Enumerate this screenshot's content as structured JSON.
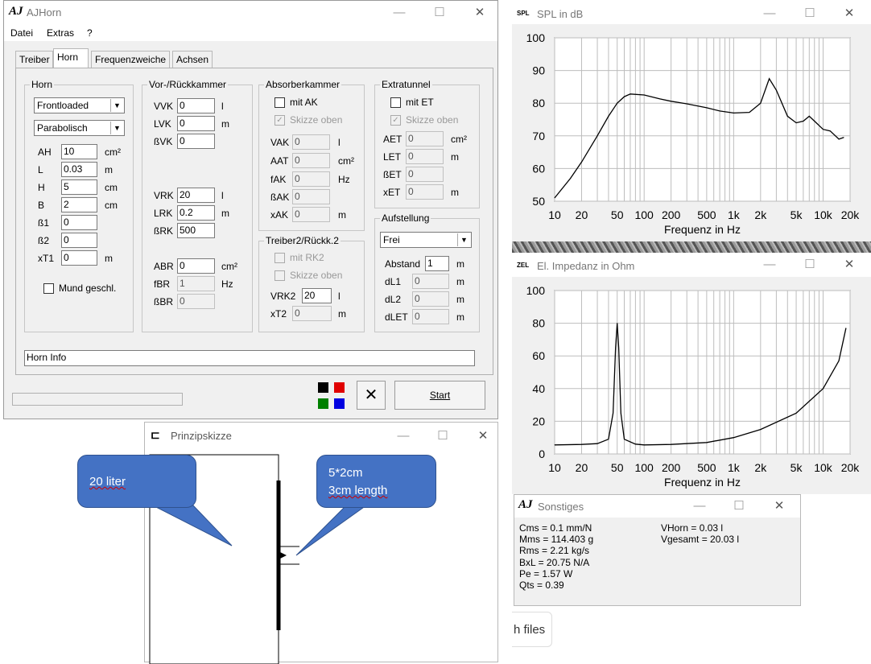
{
  "main": {
    "title": "AJHorn",
    "icon_text": "AJ",
    "menu": [
      "Datei",
      "Extras",
      "?"
    ],
    "tabs": [
      "Treiber",
      "Horn",
      "Frequenzweiche",
      "Achsen"
    ],
    "horn": {
      "title": "Horn",
      "type": "Frontloaded",
      "shape": "Parabolisch",
      "fields": [
        {
          "label": "AH",
          "value": "10",
          "unit": "cm²"
        },
        {
          "label": "L",
          "value": "0.03",
          "unit": "m"
        },
        {
          "label": "H",
          "value": "5",
          "unit": "cm"
        },
        {
          "label": "B",
          "value": "2",
          "unit": "cm"
        },
        {
          "label": "ß1",
          "value": "0",
          "unit": ""
        },
        {
          "label": "ß2",
          "value": "0",
          "unit": ""
        },
        {
          "label": "xT1",
          "value": "0",
          "unit": "m"
        }
      ],
      "mouth_closed": "Mund geschl."
    },
    "chamber": {
      "title": "Vor-/Rückkammer",
      "front": [
        {
          "label": "VVK",
          "value": "0",
          "unit": "l"
        },
        {
          "label": "LVK",
          "value": "0",
          "unit": "m"
        },
        {
          "label": "ßVK",
          "value": "0",
          "unit": ""
        }
      ],
      "rear": [
        {
          "label": "VRK",
          "value": "20",
          "unit": "l"
        },
        {
          "label": "LRK",
          "value": "0.2",
          "unit": "m"
        },
        {
          "label": "ßRK",
          "value": "500",
          "unit": ""
        }
      ],
      "bass": [
        {
          "label": "ABR",
          "value": "0",
          "unit": "cm²"
        },
        {
          "label": "fBR",
          "value": "1",
          "unit": "Hz"
        },
        {
          "label": "ßBR",
          "value": "0",
          "unit": ""
        }
      ]
    },
    "absorber": {
      "title": "Absorberkammer",
      "mit_ak": "mit AK",
      "skizze": "Skizze oben",
      "fields": [
        {
          "label": "VAK",
          "value": "0",
          "unit": "l"
        },
        {
          "label": "AAT",
          "value": "0",
          "unit": "cm²"
        },
        {
          "label": "fAK",
          "value": "0",
          "unit": "Hz"
        },
        {
          "label": "ßAK",
          "value": "0",
          "unit": ""
        },
        {
          "label": "xAK",
          "value": "0",
          "unit": "m"
        }
      ]
    },
    "extratunnel": {
      "title": "Extratunnel",
      "mit_et": "mit ET",
      "skizze": "Skizze oben",
      "fields": [
        {
          "label": "AET",
          "value": "0",
          "unit": "cm²"
        },
        {
          "label": "LET",
          "value": "0",
          "unit": "m"
        },
        {
          "label": "ßET",
          "value": "0",
          "unit": ""
        },
        {
          "label": "xET",
          "value": "0",
          "unit": "m"
        }
      ]
    },
    "treiber2": {
      "title": "Treiber2/Rückk.2",
      "mit_rk2": "mit RK2",
      "skizze": "Skizze oben",
      "fields": [
        {
          "label": "VRK2",
          "value": "20",
          "unit": "l"
        },
        {
          "label": "xT2",
          "value": "0",
          "unit": "m"
        }
      ]
    },
    "aufstellung": {
      "title": "Aufstellung",
      "mode": "Frei",
      "fields": [
        {
          "label": "Abstand",
          "value": "1",
          "unit": "m"
        },
        {
          "label": "dL1",
          "value": "0",
          "unit": "m"
        },
        {
          "label": "dL2",
          "value": "0",
          "unit": "m"
        },
        {
          "label": "dLET",
          "value": "0",
          "unit": "m"
        }
      ]
    },
    "info": "Horn Info",
    "start": "Start",
    "colors": [
      "#000000",
      "#e00000",
      "#008000",
      "#0000e0"
    ]
  },
  "spl": {
    "badge": "SPL",
    "title": "SPL in dB",
    "y_ticks": [
      "100",
      "90",
      "80",
      "70",
      "60",
      "50"
    ],
    "x_ticks": [
      "10",
      "20",
      "50",
      "100",
      "200",
      "500",
      "1k",
      "2k",
      "5k",
      "10k",
      "20k"
    ],
    "xlabel": "Frequenz in Hz"
  },
  "zel": {
    "badge": "ZEL",
    "title": "El. Impedanz in Ohm",
    "y_ticks": [
      "100",
      "80",
      "60",
      "40",
      "20",
      "0"
    ],
    "x_ticks": [
      "10",
      "20",
      "50",
      "100",
      "200",
      "500",
      "1k",
      "2k",
      "5k",
      "10k",
      "20k"
    ],
    "xlabel": "Frequenz in Hz"
  },
  "sonst": {
    "title": "Sonstiges",
    "left": [
      "Cms = 0.1 mm/N",
      "Mms = 114.403 g",
      "Rms = 2.21 kg/s",
      "BxL = 20.75 N/A",
      "Pe = 1.57 W",
      "Qts = 0.39"
    ],
    "right": [
      "VHorn = 0.03 l",
      "Vgesamt = 20.03 l"
    ]
  },
  "skizze": {
    "title": "Prinzipskizze",
    "balloon1": "20 liter",
    "balloon2_line1": "5*2cm",
    "balloon2_line2": "3cm length"
  },
  "files_button": "h files",
  "chart_data": [
    {
      "type": "line",
      "title": "SPL in dB",
      "xlabel": "Frequenz in Hz",
      "ylabel": "",
      "x_scale": "log",
      "xlim": [
        10,
        20000
      ],
      "ylim": [
        50,
        100
      ],
      "grid": true,
      "series": [
        {
          "points": [
            [
              10,
              51
            ],
            [
              15,
              57
            ],
            [
              20,
              62
            ],
            [
              30,
              70
            ],
            [
              40,
              76
            ],
            [
              50,
              80
            ],
            [
              60,
              82
            ],
            [
              70,
              82.8
            ],
            [
              100,
              82.5
            ],
            [
              150,
              81.3
            ],
            [
              200,
              80.6
            ],
            [
              300,
              79.8
            ],
            [
              500,
              78.6
            ],
            [
              700,
              77.6
            ],
            [
              1000,
              77
            ],
            [
              1500,
              77.2
            ],
            [
              2000,
              80
            ],
            [
              2500,
              87.5
            ],
            [
              3000,
              84
            ],
            [
              4000,
              76
            ],
            [
              5000,
              74
            ],
            [
              6000,
              74.5
            ],
            [
              7000,
              76
            ],
            [
              8000,
              74.5
            ],
            [
              10000,
              72
            ],
            [
              12000,
              71.5
            ],
            [
              15000,
              69
            ],
            [
              17000,
              69.5
            ]
          ]
        }
      ]
    },
    {
      "type": "line",
      "title": "El. Impedanz in Ohm",
      "xlabel": "Frequenz in Hz",
      "ylabel": "",
      "x_scale": "log",
      "xlim": [
        10,
        20000
      ],
      "ylim": [
        0,
        100
      ],
      "grid": true,
      "series": [
        {
          "points": [
            [
              10,
              5.5
            ],
            [
              20,
              5.8
            ],
            [
              30,
              6.3
            ],
            [
              40,
              9
            ],
            [
              45,
              25
            ],
            [
              48,
              65
            ],
            [
              50,
              80
            ],
            [
              52,
              65
            ],
            [
              55,
              25
            ],
            [
              60,
              9
            ],
            [
              80,
              6
            ],
            [
              100,
              5.5
            ],
            [
              200,
              5.8
            ],
            [
              500,
              7
            ],
            [
              1000,
              10
            ],
            [
              2000,
              15
            ],
            [
              5000,
              25
            ],
            [
              10000,
              40
            ],
            [
              15000,
              57
            ],
            [
              18000,
              77
            ]
          ]
        }
      ]
    }
  ]
}
